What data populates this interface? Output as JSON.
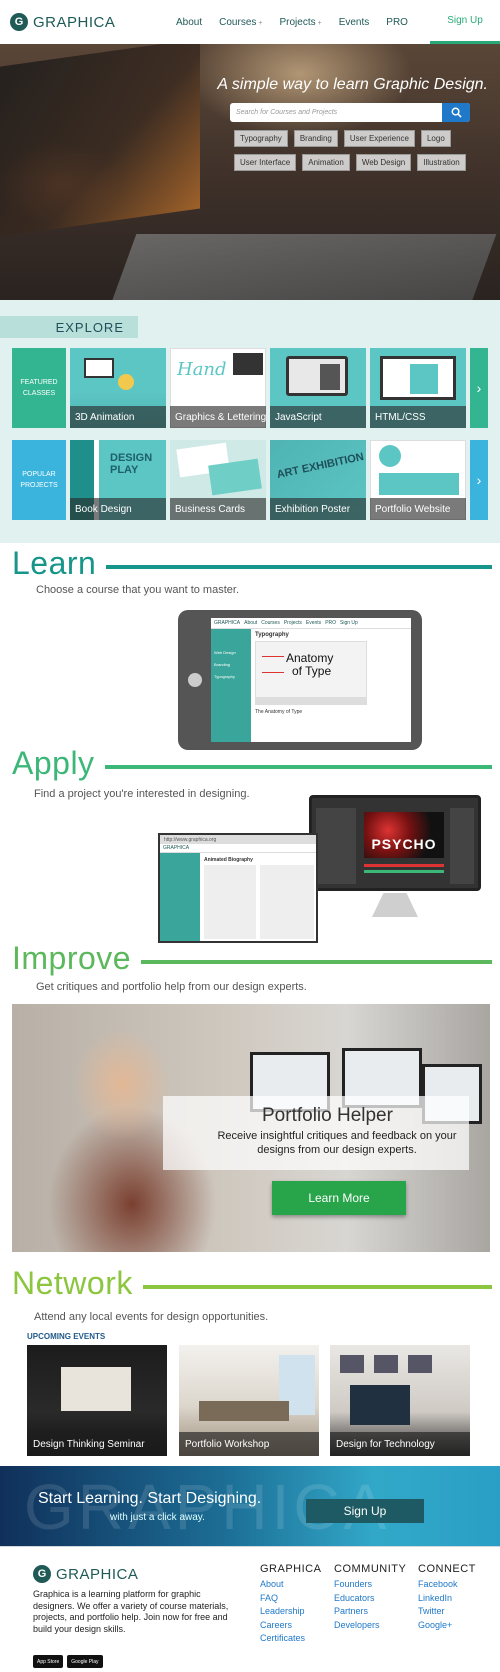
{
  "brand": {
    "name": "GRAPHICA",
    "mark": "G"
  },
  "nav": {
    "links": [
      {
        "label": "About",
        "caret": false
      },
      {
        "label": "Courses",
        "caret": true
      },
      {
        "label": "Projects",
        "caret": true
      },
      {
        "label": "Events",
        "caret": false
      },
      {
        "label": "PRO",
        "caret": false
      }
    ],
    "signup": "Sign Up",
    "caret_glyph": "+"
  },
  "hero": {
    "title": "A simple way to learn Graphic Design.",
    "search_placeholder": "Search for Courses and Projects",
    "tags": [
      "Typography",
      "Branding",
      "User Experience",
      "Logo",
      "User Interface",
      "Animation",
      "Web Design",
      "Illustration"
    ]
  },
  "explore": {
    "label": "EXPLORE",
    "featured": {
      "label_line1": "FEATURED",
      "label_line2": "CLASSES",
      "cards": [
        "3D Animation",
        "Graphics & Lettering",
        "JavaScript",
        "HTML/CSS"
      ]
    },
    "popular": {
      "label_line1": "POPULAR",
      "label_line2": "PROJECTS",
      "cards": [
        "Book Design",
        "Business Cards",
        "Exhibition Poster",
        "Portfolio Website"
      ]
    },
    "arrow": "›"
  },
  "learn": {
    "title": "Learn",
    "subtitle": "Choose a course that you want to master.",
    "mock": {
      "page_heading": "Typography",
      "card_title_1": "Anatomy",
      "card_title_2": "of Type",
      "lesson_title": "The Anatomy of Type",
      "side_items": [
        "Web Design",
        "Branding",
        "Typography"
      ]
    }
  },
  "apply": {
    "title": "Apply",
    "subtitle": "Find a project you're interested in designing.",
    "mock": {
      "url": "http://www.graphica.org",
      "heading": "Animated Biography",
      "poster": "PSYCHO"
    }
  },
  "improve": {
    "title": "Improve",
    "subtitle": "Get critiques and portfolio help from our design experts.",
    "helper_title": "Portfolio Helper",
    "helper_text": "Receive insightful critiques and feedback on your designs from our design experts.",
    "button": "Learn More"
  },
  "network": {
    "title": "Network",
    "subtitle": "Attend any local events for design opportunities.",
    "events_label": "UPCOMING EVENTS",
    "events": [
      "Design Thinking Seminar",
      "Portfolio Workshop",
      "Design for Technology"
    ]
  },
  "cta": {
    "watermark": "GRAPHICA",
    "title": "Start Learning. Start Designing.",
    "subtitle": "with just a click away.",
    "button": "Sign Up"
  },
  "footer": {
    "description": "Graphica is a learning platform for graphic designers. We offer a variety of course materials, projects, and portfolio help. Join now for free and build your design skills.",
    "badges": [
      "App Store",
      "Google Play"
    ],
    "columns": [
      {
        "title": "GRAPHICA",
        "links": [
          "About",
          "FAQ",
          "Leadership",
          "Careers",
          "Certificates"
        ]
      },
      {
        "title": "COMMUNITY",
        "links": [
          "Founders",
          "Educators",
          "Partners",
          "Developers"
        ]
      },
      {
        "title": "CONNECT",
        "links": [
          "Facebook",
          "LinkedIn",
          "Twitter",
          "Google+"
        ]
      }
    ]
  },
  "colors": {
    "learn": "#16968a",
    "apply": "#3bb778",
    "improve": "#5cb85c",
    "network": "#8cc63f",
    "featured": "#33b592",
    "popular": "#3bb4dd"
  },
  "icons": {
    "search": "search-icon",
    "logo": "graphica-logo-icon",
    "arrow": "chevron-right-icon"
  }
}
